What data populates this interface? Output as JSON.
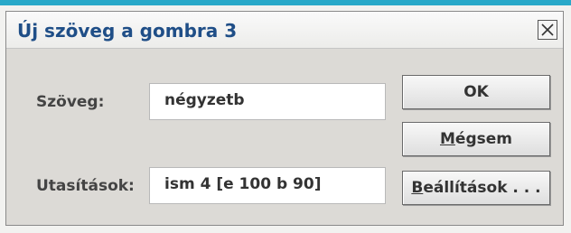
{
  "dialog": {
    "title": "Új szöveg a gombra 3",
    "close_icon": "close-x-icon"
  },
  "form": {
    "text_label": "Szöveg:",
    "text_value": "négyzetb",
    "instructions_label": "Utasítások:",
    "instructions_value": "ism 4 [e 100 b 90]"
  },
  "buttons": {
    "ok": "OK",
    "cancel_mnemonic": "M",
    "cancel_rest": "égsem",
    "settings_mnemonic": "B",
    "settings_rest": "eállítások . . ."
  },
  "colors": {
    "title": "#1f4e87",
    "top_accent": "#29a9c9",
    "dialog_bg": "#dcdad6"
  }
}
